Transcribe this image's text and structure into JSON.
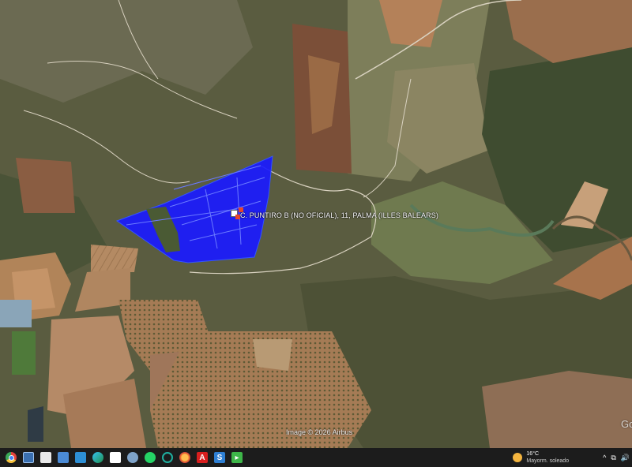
{
  "map": {
    "placemark_label": "C. PUNTIRO B (NO OFICIAL), 11, PALMA (ILLES BALEARS)",
    "attribution": "Image © 2026 Airbus",
    "provider_logo": "Goo",
    "colors": {
      "parcel_fill": "#1a1aff",
      "parcel_stroke": "#3355ff",
      "marker_red": "#e7452c"
    }
  },
  "taskbar": {
    "icons": [
      "chrome-icon",
      "app-icon",
      "files-icon",
      "people-icon",
      "photos-icon",
      "edge-icon",
      "document-icon",
      "globe-icon",
      "whatsapp-icon",
      "refresh-app-icon",
      "firefox-icon",
      "acrobat-icon",
      "app-s-icon",
      "media-icon"
    ],
    "weather": {
      "temperature": "16°C",
      "description": "Mayorm. soleado"
    },
    "tray_glyphs": {
      "chevron": "^",
      "display": "⧉",
      "volume": "🔊"
    }
  }
}
